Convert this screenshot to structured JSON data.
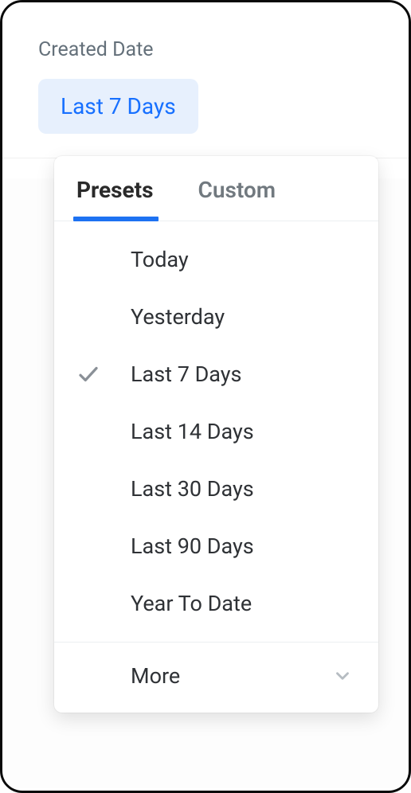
{
  "filter": {
    "label": "Created Date",
    "selected_value": "Last 7 Days"
  },
  "dropdown": {
    "tabs": {
      "presets": "Presets",
      "custom": "Custom",
      "active": "presets"
    },
    "options": [
      {
        "label": "Today",
        "selected": false
      },
      {
        "label": "Yesterday",
        "selected": false
      },
      {
        "label": "Last 7 Days",
        "selected": true
      },
      {
        "label": "Last 14 Days",
        "selected": false
      },
      {
        "label": "Last 30 Days",
        "selected": false
      },
      {
        "label": "Last 90 Days",
        "selected": false
      },
      {
        "label": "Year To Date",
        "selected": false
      }
    ],
    "more_label": "More"
  }
}
